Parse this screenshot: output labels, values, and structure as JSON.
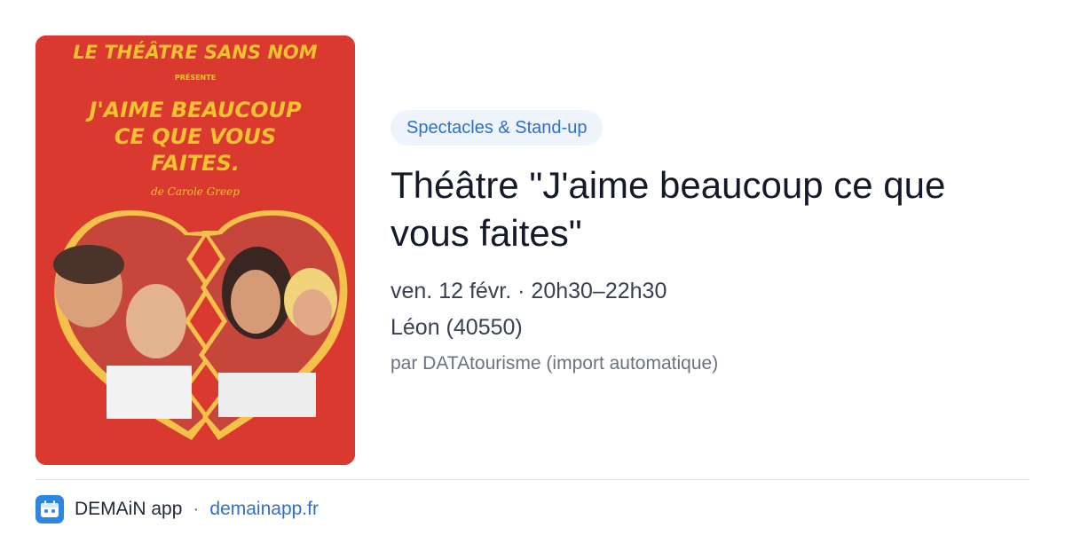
{
  "poster": {
    "line1": "LE THÉÂTRE SANS NOM",
    "line2": "PRÉSENTE",
    "title_line1": "J'AIME BEAUCOUP",
    "title_line2": "CE QUE VOUS",
    "title_line3": "FAITES.",
    "author": "de Carole Greep"
  },
  "event": {
    "category": "Spectacles & Stand-up",
    "title": "Théâtre \"J'aime beaucoup ce que vous faites\"",
    "datetime": "ven. 12 févr. · 20h30–22h30",
    "location": "Léon (40550)",
    "source": "par DATAtourisme (import automatique)"
  },
  "footer": {
    "app_name": "DEMAiN app",
    "separator": "·",
    "site": "demainapp.fr"
  },
  "colors": {
    "poster_bg": "#d9392e",
    "poster_text": "#f2c230",
    "accent": "#2f6fd0"
  }
}
